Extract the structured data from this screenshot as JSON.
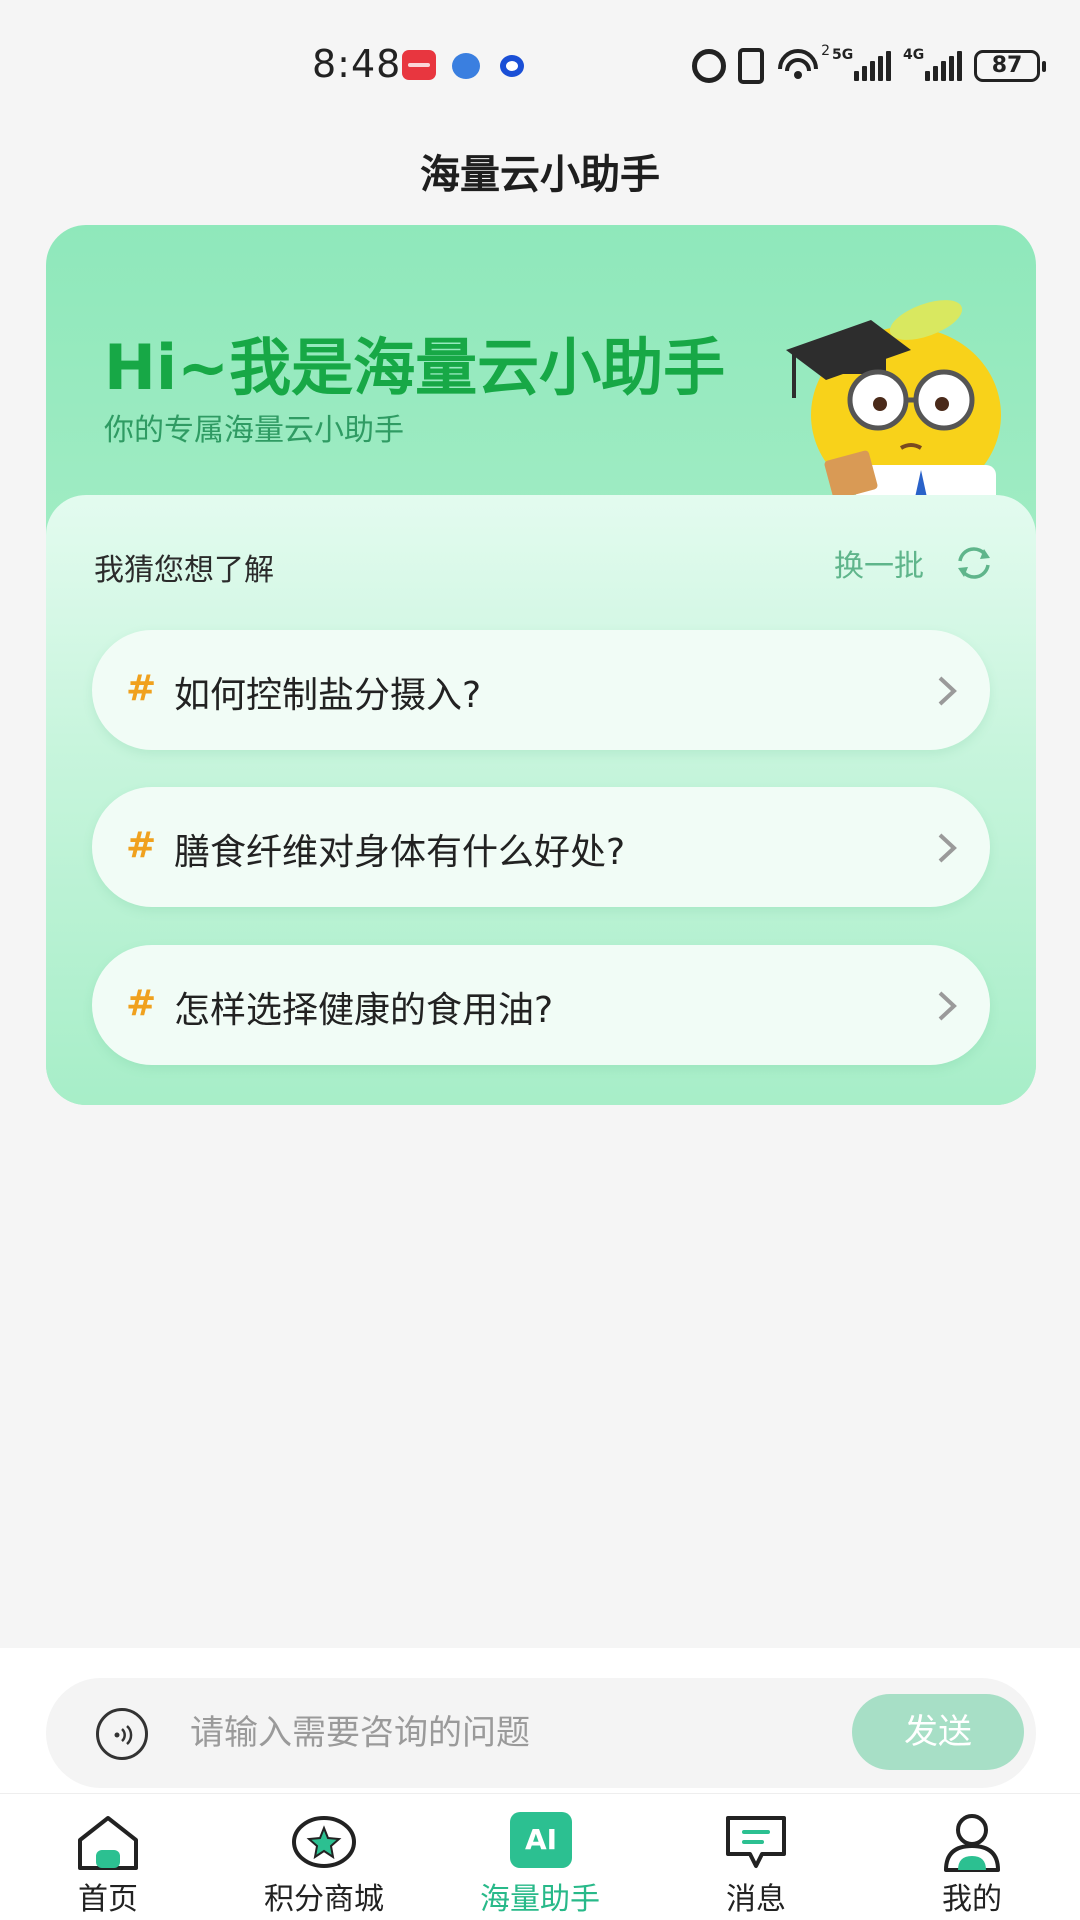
{
  "status_bar": {
    "time": "8:48",
    "signal_1_label": "5G",
    "signal_2_label": "4G",
    "wifi_sup": "2",
    "battery": "87"
  },
  "header": {
    "title": "海量云小助手"
  },
  "hero": {
    "title": "Hi~我是海量云小助手",
    "subtitle": "你的专属海量云小助手"
  },
  "suggestions": {
    "label": "我猜您想了解",
    "refresh_label": "换一批",
    "hash": "#",
    "items": [
      "如何控制盐分摄入?",
      "膳食纤维对身体有什么好处?",
      "怎样选择健康的食用油?"
    ]
  },
  "chat_input": {
    "placeholder": "请输入需要咨询的问题",
    "send_label": "发送"
  },
  "tabs": [
    {
      "label": "首页",
      "icon": "home-icon"
    },
    {
      "label": "积分商城",
      "icon": "star-badge-icon"
    },
    {
      "label": "海量助手",
      "icon": "ai-icon",
      "badge": "AI",
      "active": true
    },
    {
      "label": "消息",
      "icon": "message-icon"
    },
    {
      "label": "我的",
      "icon": "profile-icon"
    }
  ],
  "colors": {
    "accent": "#28b989",
    "hero_title": "#17a846",
    "hash": "#f0a11e",
    "send_button": "#a7dfc6"
  }
}
